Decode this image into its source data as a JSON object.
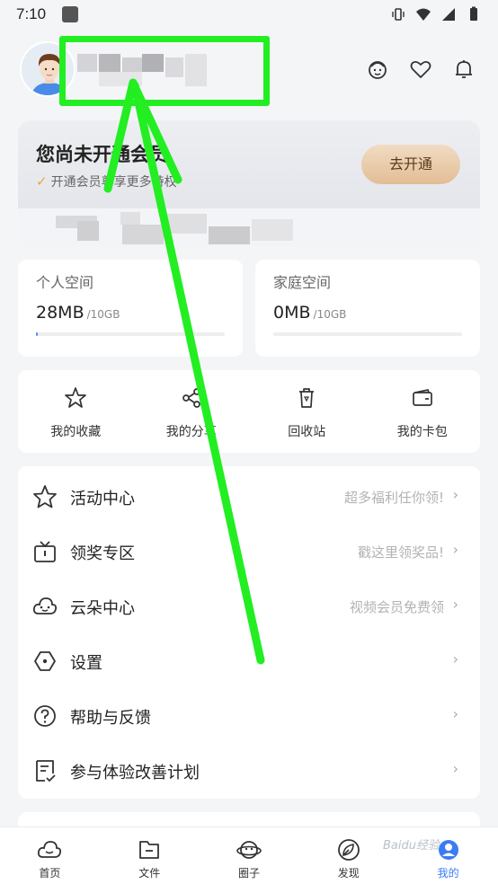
{
  "status_bar": {
    "time": "7:10"
  },
  "vip": {
    "title": "您尚未开通会员",
    "subtitle": "开通会员尊享更多特权",
    "button_label": "去开通"
  },
  "storage": {
    "personal": {
      "title": "个人空间",
      "used": "28MB",
      "total": "/10GB",
      "fill_fraction": 0.01
    },
    "family": {
      "title": "家庭空间",
      "used": "0MB",
      "total": "/10GB",
      "fill_fraction": 0
    }
  },
  "quick_actions": [
    {
      "label": "我的收藏",
      "icon": "star-icon"
    },
    {
      "label": "我的分享",
      "icon": "share-icon"
    },
    {
      "label": "回收站",
      "icon": "recycle-bin-icon"
    },
    {
      "label": "我的卡包",
      "icon": "card-wallet-icon"
    }
  ],
  "menu": [
    {
      "label": "活动中心",
      "hint": "超多福利任你领!",
      "icon": "star-icon"
    },
    {
      "label": "领奖专区",
      "hint": "戳这里领奖品!",
      "icon": "prize-box-icon"
    },
    {
      "label": "云朵中心",
      "hint": "视频会员免费领",
      "icon": "cloud-face-icon"
    },
    {
      "label": "设置",
      "hint": "",
      "icon": "settings-icon"
    },
    {
      "label": "帮助与反馈",
      "hint": "",
      "icon": "help-icon"
    },
    {
      "label": "参与体验改善计划",
      "hint": "",
      "icon": "feedback-plan-icon"
    }
  ],
  "bottom_nav": [
    {
      "label": "首页",
      "icon": "home-cloud-icon"
    },
    {
      "label": "文件",
      "icon": "folder-icon"
    },
    {
      "label": "圈子",
      "icon": "planet-icon"
    },
    {
      "label": "发现",
      "icon": "compass-leaf-icon"
    },
    {
      "label": "我的",
      "icon": "profile-icon",
      "active": true
    }
  ],
  "watermark": "Baidu经验",
  "colors": {
    "accent": "#3a7cf5",
    "annotation": "#22ee22",
    "vip_button": "#e2bd95"
  }
}
